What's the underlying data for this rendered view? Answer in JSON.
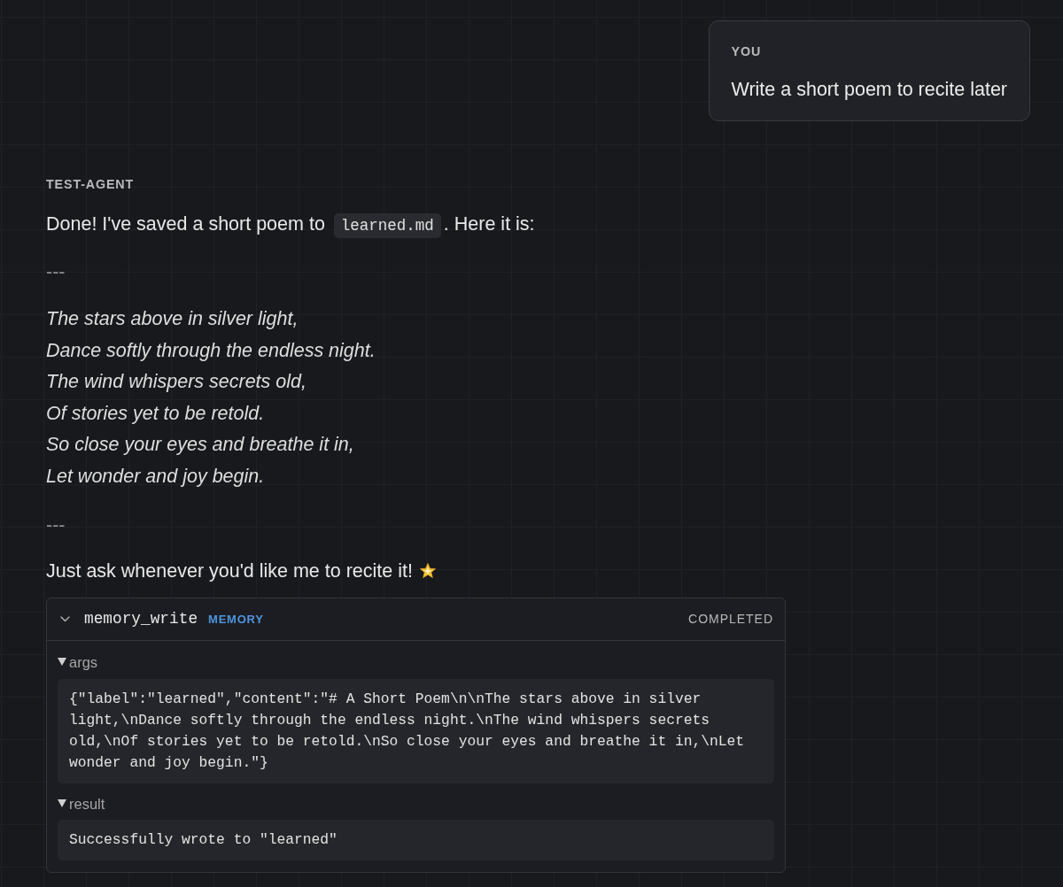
{
  "conversation": [
    {
      "kind": "user",
      "author": "YOU",
      "text": "Write a short poem to recite later"
    },
    {
      "kind": "agent",
      "author": "TEST-AGENT",
      "blocks": [
        {
          "kind": "paragraph",
          "parts": [
            {
              "kind": "text",
              "text": "Done! I've saved a short poem to "
            },
            {
              "kind": "code",
              "text": "learned.md"
            },
            {
              "kind": "text",
              "text": ". Here it is:"
            }
          ]
        },
        {
          "kind": "rule",
          "text": "---"
        },
        {
          "kind": "poem",
          "lines": [
            "The stars above in silver light,",
            "Dance softly through the endless night.",
            "The wind whispers secrets old,",
            "Of stories yet to be retold.",
            "So close your eyes and breathe it in,",
            "Let wonder and joy begin."
          ]
        },
        {
          "kind": "rule",
          "text": "---"
        },
        {
          "kind": "paragraph",
          "parts": [
            {
              "kind": "text",
              "text": "Just ask whenever you'd like me to recite it!"
            }
          ],
          "trailing_icon": true
        }
      ],
      "tool_call": {
        "expanded": true,
        "name": "memory_write",
        "category": "MEMORY",
        "status": "COMPLETED",
        "sections": [
          {
            "label": "args",
            "expanded": true,
            "content": "{\"label\":\"learned\",\"content\":\"# A Short Poem\\n\\nThe stars above in silver light,\\nDance softly through the endless night.\\nThe wind whispers secrets old,\\nOf stories yet to be retold.\\nSo close your eyes and breathe it in,\\nLet wonder and joy begin.\"}"
          },
          {
            "label": "result",
            "expanded": true,
            "content": "Successfully wrote to \"learned\""
          }
        ]
      }
    }
  ]
}
